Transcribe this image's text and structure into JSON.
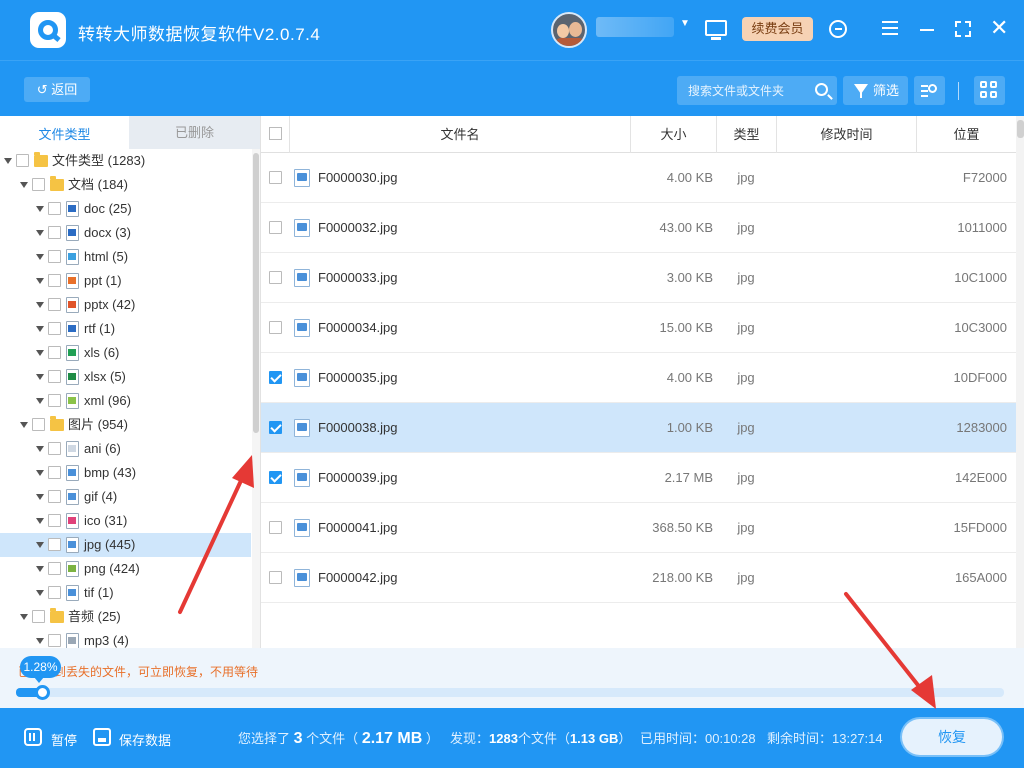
{
  "app": {
    "title": "转转大师数据恢复软件V2.0.7.4",
    "vip_label": "续费会员"
  },
  "toolbar": {
    "back_label": "返回",
    "search_placeholder": "搜索文件或文件夹",
    "filter_label": "筛选"
  },
  "left": {
    "tabs": [
      {
        "label": "文件类型",
        "active": true
      },
      {
        "label": "已删除",
        "active": false
      }
    ],
    "tree": [
      {
        "label": "文件类型 (1283)",
        "level": 0,
        "kind": "folder"
      },
      {
        "label": "文档 (184)",
        "level": 1,
        "kind": "folder"
      },
      {
        "label": "doc (25)",
        "level": 2,
        "kind": "file",
        "color": "#2b6cc4"
      },
      {
        "label": "docx (3)",
        "level": 2,
        "kind": "file",
        "color": "#2b6cc4"
      },
      {
        "label": "html (5)",
        "level": 2,
        "kind": "file",
        "color": "#3aa0e0"
      },
      {
        "label": "ppt (1)",
        "level": 2,
        "kind": "file",
        "color": "#e8702a"
      },
      {
        "label": "pptx (42)",
        "level": 2,
        "kind": "file",
        "color": "#e0542a"
      },
      {
        "label": "rtf (1)",
        "level": 2,
        "kind": "file",
        "color": "#2b6cc4"
      },
      {
        "label": "xls (6)",
        "level": 2,
        "kind": "file",
        "color": "#21a055"
      },
      {
        "label": "xlsx (5)",
        "level": 2,
        "kind": "file",
        "color": "#1e8c46"
      },
      {
        "label": "xml (96)",
        "level": 2,
        "kind": "file",
        "color": "#8bc34a"
      },
      {
        "label": "图片 (954)",
        "level": 1,
        "kind": "folder"
      },
      {
        "label": "ani (6)",
        "level": 2,
        "kind": "file",
        "color": "#cfd8e3"
      },
      {
        "label": "bmp (43)",
        "level": 2,
        "kind": "file",
        "color": "#4a90d9"
      },
      {
        "label": "gif (4)",
        "level": 2,
        "kind": "file",
        "color": "#4a90d9"
      },
      {
        "label": "ico (31)",
        "level": 2,
        "kind": "file",
        "color": "#e0427a"
      },
      {
        "label": "jpg (445)",
        "level": 2,
        "kind": "file",
        "color": "#4a90d9",
        "selected": true
      },
      {
        "label": "png (424)",
        "level": 2,
        "kind": "file",
        "color": "#7cb342"
      },
      {
        "label": "tif (1)",
        "level": 2,
        "kind": "file",
        "color": "#4a90d9"
      },
      {
        "label": "音频 (25)",
        "level": 1,
        "kind": "folder"
      },
      {
        "label": "mp3 (4)",
        "level": 2,
        "kind": "file",
        "color": "#9aa7b5"
      }
    ]
  },
  "table": {
    "columns": [
      "文件名",
      "大小",
      "类型",
      "修改时间",
      "位置"
    ],
    "rows": [
      {
        "name": "F0000030.jpg",
        "size": "4.00 KB",
        "type": "jpg",
        "modified": "",
        "location": "F72000",
        "checked": false
      },
      {
        "name": "F0000032.jpg",
        "size": "43.00 KB",
        "type": "jpg",
        "modified": "",
        "location": "1011000",
        "checked": false
      },
      {
        "name": "F0000033.jpg",
        "size": "3.00 KB",
        "type": "jpg",
        "modified": "",
        "location": "10C1000",
        "checked": false
      },
      {
        "name": "F0000034.jpg",
        "size": "15.00 KB",
        "type": "jpg",
        "modified": "",
        "location": "10C3000",
        "checked": false
      },
      {
        "name": "F0000035.jpg",
        "size": "4.00 KB",
        "type": "jpg",
        "modified": "",
        "location": "10DF000",
        "checked": true
      },
      {
        "name": "F0000038.jpg",
        "size": "1.00 KB",
        "type": "jpg",
        "modified": "",
        "location": "1283000",
        "checked": true,
        "highlight": true
      },
      {
        "name": "F0000039.jpg",
        "size": "2.17 MB",
        "type": "jpg",
        "modified": "",
        "location": "142E000",
        "checked": true
      },
      {
        "name": "F0000041.jpg",
        "size": "368.50 KB",
        "type": "jpg",
        "modified": "",
        "location": "15FD000",
        "checked": false
      },
      {
        "name": "F0000042.jpg",
        "size": "218.00 KB",
        "type": "jpg",
        "modified": "",
        "location": "165A000",
        "checked": false
      }
    ]
  },
  "progress": {
    "percent_label": "1.28%",
    "percent": 1.28,
    "message": "已扫描到丢失的文件，可立即恢复，不用等待"
  },
  "bottom": {
    "pause_label": "暂停",
    "save_label": "保存数据",
    "selected_prefix": "您选择了",
    "selected_count": "3",
    "selected_mid": "个文件（",
    "selected_size": "2.17 MB",
    "selected_suffix": "）",
    "found_prefix": "发现：",
    "found_count": "1283",
    "found_mid": "个文件（",
    "found_size": "1.13 GB",
    "found_suffix": "）",
    "elapsed_label": "已用时间：",
    "elapsed": "00:10:28",
    "remaining_label": "剩余时间：",
    "remaining": "13:27:14",
    "recover_label": "恢复"
  },
  "colors": {
    "primary": "#2196f3",
    "accent_orange": "#e8702a",
    "arrow": "#e53935"
  }
}
